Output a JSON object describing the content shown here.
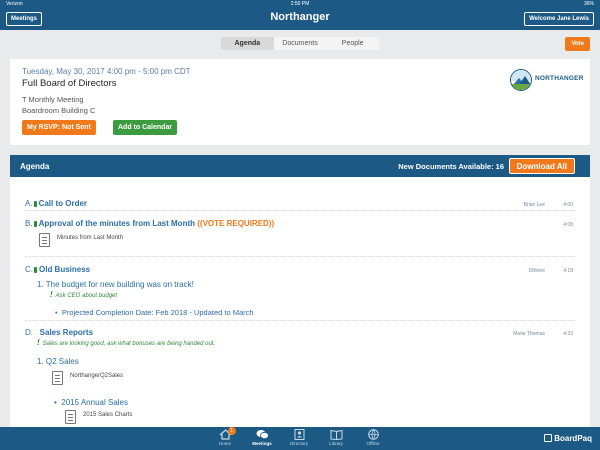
{
  "status": {
    "carrier": "Verizon",
    "time": "2:50 PM",
    "battery": "36%"
  },
  "nav": {
    "meetings_label": "Meetings",
    "title": "Northanger",
    "welcome_label": "Welcome Jane Lewis"
  },
  "tabs": {
    "items": [
      "Agenda",
      "Documents",
      "People"
    ],
    "active": "Agenda"
  },
  "vote_label": "Vote",
  "meeting": {
    "datetime": "Tuesday, May 30, 2017  4:00 pm - 5:00 pm CDT",
    "name": "Full Board of Directors",
    "type": "T Monthly Meeting",
    "location": "Boardroom Building C",
    "rsvp_label": "My RSVP: Not Sent",
    "calendar_label": "Add to Calendar",
    "logo_text": "NORTHANGER"
  },
  "agenda": {
    "title": "Agenda",
    "new_docs": "New Documents Available: 16",
    "download_all": "Download All",
    "items": [
      {
        "letter": "A.",
        "title": "Call to Order",
        "presenter": "Brian Lee",
        "time": "4:00"
      },
      {
        "letter": "B.",
        "title": "Approval of the minutes from Last Month",
        "vote": "((VOTE REQUIRED))",
        "time": "4:08",
        "doc": "Minutes from Last Month"
      },
      {
        "letter": "C.",
        "title": "Old Business",
        "presenter": "Dillione",
        "time": "4:18",
        "sub": "1.  The budget for new building was on track!",
        "note": "Ask CEO about budget",
        "bullet": "Projected Completion Date: Feb 2018 - Updated to March"
      },
      {
        "letter": "D.",
        "title": "Sales Reports",
        "presenter": "Marie Thomas",
        "time": "4:33",
        "note": "Sales are looking good, ask what bonuses are being handed out.",
        "sub": "1.  Q2 Sales",
        "doc": "NorthangerQ2Sales",
        "bullet": "2015 Annual Sales",
        "doc2": "2015 Sales Charts"
      }
    ]
  },
  "tabbar": {
    "items": [
      "Home",
      "Meetings",
      "Directory",
      "Library",
      "Offline"
    ],
    "active": "Meetings",
    "home_badge": "1",
    "brand": "BoardPaq"
  }
}
